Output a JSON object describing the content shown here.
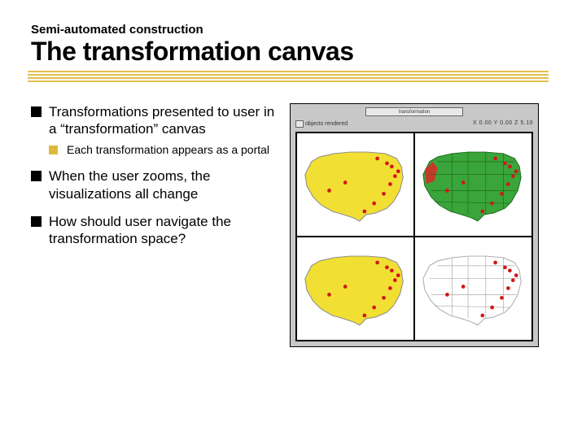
{
  "kicker": "Semi-automated construction",
  "title": "The transformation canvas",
  "bullets": [
    {
      "text": "Transformations presented to user in a “transformation” canvas",
      "sub": [
        {
          "text": "Each transformation appears as a portal"
        }
      ]
    },
    {
      "text": "When the user zooms, the visualizations all change",
      "sub": []
    },
    {
      "text": "How should user navigate the transformation space?",
      "sub": []
    }
  ],
  "figure": {
    "header_center": "transformation",
    "header_left": "objects rendered",
    "header_right": "X 0.00 Y 0.00 Z 5.10",
    "cells": [
      {
        "fill": "#f2df33",
        "dots": true,
        "outline": "#888"
      },
      {
        "fill": "#3aa53a",
        "dots": true,
        "outline": "#1d6b1d",
        "states": true,
        "redpatch": true
      },
      {
        "fill": "#f2df33",
        "dots": true,
        "outline": "#888"
      },
      {
        "fill": "#ffffff",
        "dots": true,
        "outline": "#aaa",
        "states": true
      }
    ]
  }
}
